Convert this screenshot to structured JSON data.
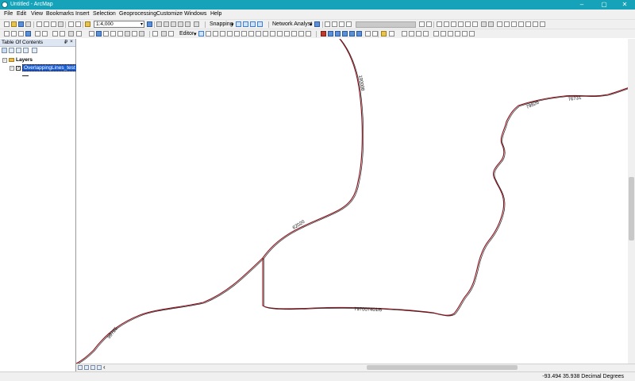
{
  "window": {
    "title": "Untitled - ArcMap",
    "minimize": "–",
    "maximize": "▢",
    "close": "✕"
  },
  "menu": [
    "File",
    "Edit",
    "View",
    "Bookmarks",
    "Insert",
    "Selection",
    "Geoprocessing",
    "Customize",
    "Windows",
    "Help"
  ],
  "toolbar": {
    "scale": "1:4,000",
    "snapping_label": "Snapping",
    "network_analyst_label": "Network Analyst",
    "editor_label": "Editor"
  },
  "toc": {
    "title": "Table Of Contents",
    "pin": "₽",
    "close": "×",
    "layers_group": "Layers",
    "layer_name": "OverlappingLines_test"
  },
  "map": {
    "line_color": "#8b0f1a",
    "labels": {
      "l1": "100008",
      "l2": "62020",
      "l3": "99725",
      "l4": "797007401/6",
      "l5": "79826",
      "l6": "76731"
    }
  },
  "status": {
    "coords": "-93.494  35.938 Decimal Degrees"
  }
}
